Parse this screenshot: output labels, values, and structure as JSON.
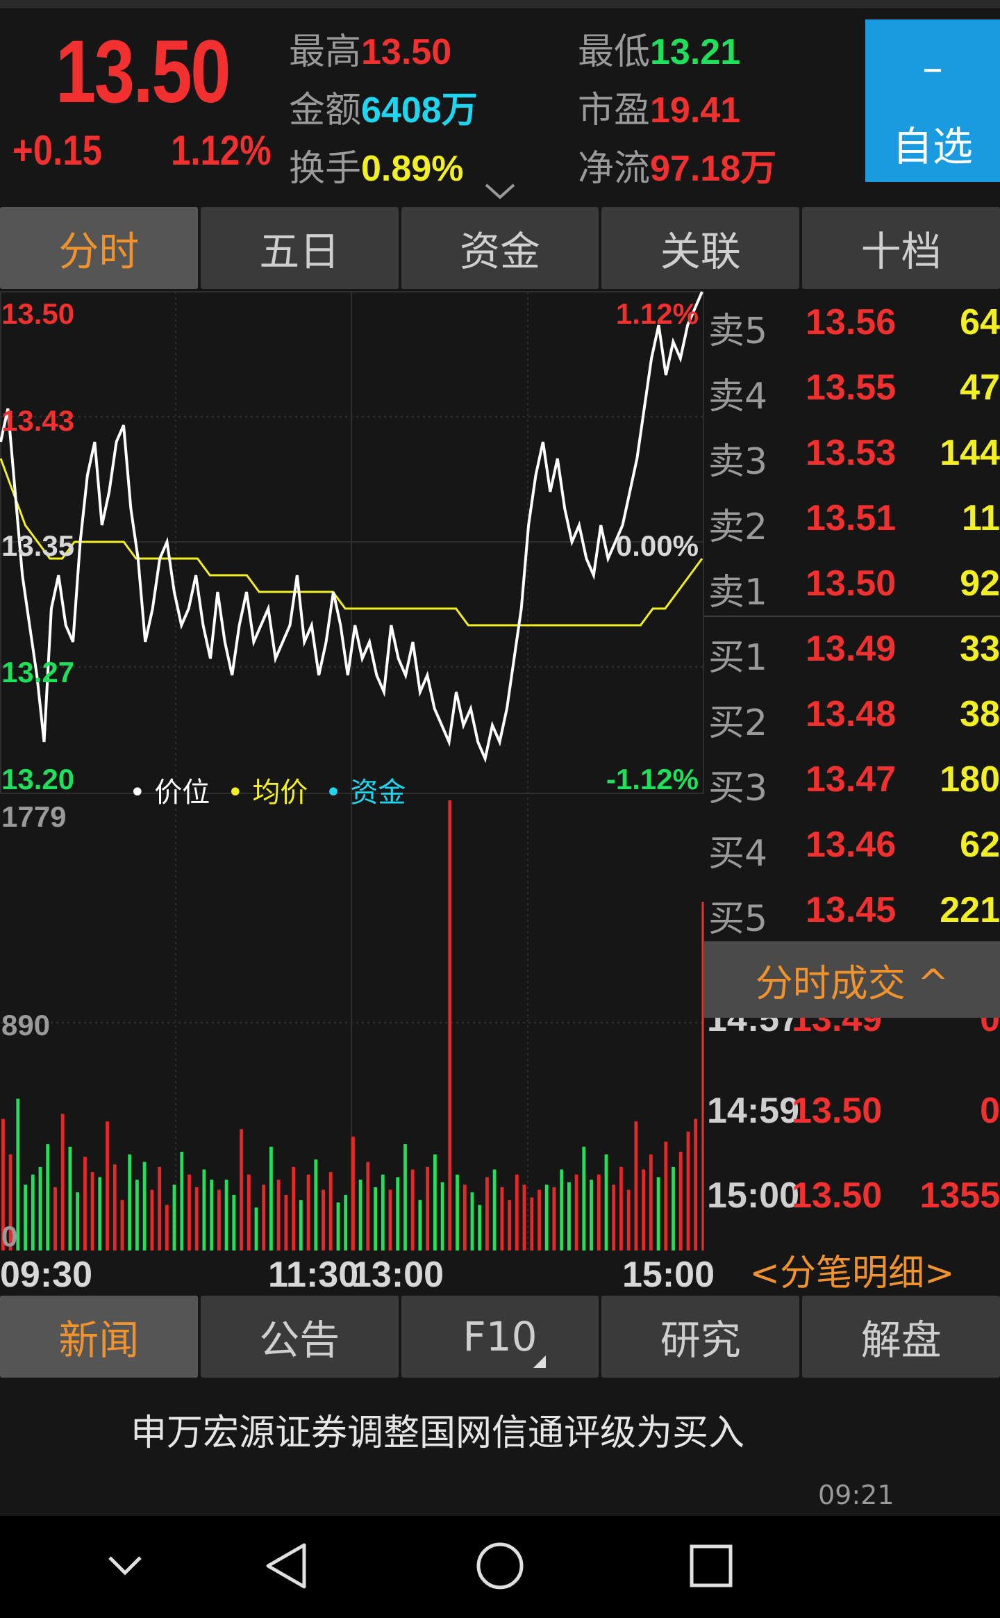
{
  "quote": {
    "price": "13.50",
    "change": "+0.15",
    "change_pct": "1.12%",
    "stats": [
      {
        "label": "最高",
        "value": "13.50",
        "color": "red"
      },
      {
        "label": "最低",
        "value": "13.21",
        "color": "green"
      },
      {
        "label": "金额",
        "value": "6408万",
        "color": "cyan"
      },
      {
        "label": "市盈",
        "value": "19.41",
        "color": "red"
      },
      {
        "label": "换手",
        "value": "0.89%",
        "color": "yellow"
      },
      {
        "label": "净流",
        "value": "97.18万",
        "color": "red"
      }
    ],
    "watch_button": {
      "icon": "minus-icon",
      "label": "自选"
    },
    "expand_icon": "chevron-down-icon"
  },
  "chart_tabs": [
    {
      "label": "分时",
      "active": true
    },
    {
      "label": "五日",
      "active": false
    },
    {
      "label": "资金",
      "active": false
    },
    {
      "label": "关联",
      "active": false
    },
    {
      "label": "十档",
      "active": false
    }
  ],
  "chart": {
    "price_axis": {
      "top": "13.50",
      "upper": "13.43",
      "mid": "13.35",
      "lower": "13.27",
      "bottom": "13.20"
    },
    "pct_axis": {
      "top": "1.12%",
      "mid": "0.00%",
      "bottom": "-1.12%"
    },
    "legend": [
      {
        "label": "价位",
        "color": "#ffffff"
      },
      {
        "label": "均价",
        "color": "#f2ef22"
      },
      {
        "label": "资金",
        "color": "#1fd6f0"
      }
    ],
    "volume_axis": {
      "top": "1779",
      "mid": "890",
      "bottom": "0"
    },
    "time_labels": [
      "09:30",
      "11:30",
      "13:00",
      "15:00"
    ]
  },
  "chart_data": {
    "type": "line",
    "ylim": [
      13.2,
      13.5
    ],
    "series": [
      {
        "name": "价位",
        "values": [
          13.41,
          13.43,
          13.38,
          13.33,
          13.3,
          13.27,
          13.23,
          13.31,
          13.33,
          13.3,
          13.29,
          13.35,
          13.39,
          13.41,
          13.36,
          13.38,
          13.41,
          13.42,
          13.37,
          13.34,
          13.29,
          13.31,
          13.34,
          13.35,
          13.32,
          13.3,
          13.31,
          13.33,
          13.3,
          13.28,
          13.32,
          13.29,
          13.27,
          13.3,
          13.32,
          13.29,
          13.3,
          13.31,
          13.28,
          13.29,
          13.3,
          13.33,
          13.29,
          13.3,
          13.27,
          13.29,
          13.32,
          13.3,
          13.27,
          13.3,
          13.28,
          13.29,
          13.27,
          13.26,
          13.3,
          13.28,
          13.27,
          13.29,
          13.26,
          13.27,
          13.25,
          13.24,
          13.23,
          13.26,
          13.24,
          13.25,
          13.23,
          13.22,
          13.24,
          13.23,
          13.25,
          13.28,
          13.31,
          13.36,
          13.39,
          13.41,
          13.38,
          13.4,
          13.37,
          13.35,
          13.36,
          13.34,
          13.33,
          13.36,
          13.34,
          13.35,
          13.36,
          13.38,
          13.4,
          13.43,
          13.46,
          13.48,
          13.45,
          13.47,
          13.46,
          13.48,
          13.49,
          13.5
        ]
      },
      {
        "name": "均价",
        "values": [
          13.4,
          13.38,
          13.36,
          13.35,
          13.34,
          13.34,
          13.35,
          13.35,
          13.35,
          13.35,
          13.35,
          13.34,
          13.34,
          13.34,
          13.34,
          13.34,
          13.34,
          13.33,
          13.33,
          13.33,
          13.33,
          13.32,
          13.32,
          13.32,
          13.32,
          13.32,
          13.32,
          13.32,
          13.31,
          13.31,
          13.31,
          13.31,
          13.31,
          13.31,
          13.31,
          13.31,
          13.31,
          13.31,
          13.3,
          13.3,
          13.3,
          13.3,
          13.3,
          13.3,
          13.3,
          13.3,
          13.3,
          13.3,
          13.3,
          13.3,
          13.3,
          13.3,
          13.3,
          13.31,
          13.31,
          13.32,
          13.33,
          13.34
        ]
      }
    ],
    "volume_ylim": [
      0,
      1779
    ],
    "volumes": [
      520,
      380,
      600,
      260,
      300,
      330,
      420,
      250,
      540,
      410,
      230,
      370,
      310,
      290,
      510,
      340,
      200,
      380,
      280,
      350,
      240,
      330,
      180,
      260,
      390,
      300,
      250,
      320,
      280,
      240,
      280,
      220,
      480,
      300,
      170,
      260,
      410,
      280,
      220,
      330,
      200,
      300,
      360,
      240,
      310,
      190,
      220,
      450,
      280,
      350,
      250,
      300,
      240,
      290,
      420,
      320,
      200,
      330,
      380,
      270,
      1779,
      300,
      260,
      230,
      180,
      290,
      320,
      250,
      200,
      300,
      260,
      210,
      240,
      260,
      250,
      320,
      270,
      300,
      410,
      280,
      300,
      380,
      260,
      330,
      240,
      510,
      320,
      380,
      290,
      430,
      330,
      390,
      470,
      520
    ],
    "volume_colors": "alternating red/green by price move"
  },
  "order_book": {
    "asks": [
      {
        "label": "卖5",
        "price": "13.56",
        "volume": "64"
      },
      {
        "label": "卖4",
        "price": "13.55",
        "volume": "47"
      },
      {
        "label": "卖3",
        "price": "13.53",
        "volume": "144"
      },
      {
        "label": "卖2",
        "price": "13.51",
        "volume": "11"
      },
      {
        "label": "卖1",
        "price": "13.50",
        "volume": "92"
      }
    ],
    "bids": [
      {
        "label": "买1",
        "price": "13.49",
        "volume": "33"
      },
      {
        "label": "买2",
        "price": "13.48",
        "volume": "38"
      },
      {
        "label": "买3",
        "price": "13.47",
        "volume": "180"
      },
      {
        "label": "买4",
        "price": "13.46",
        "volume": "62"
      },
      {
        "label": "买5",
        "price": "13.45",
        "volume": "221"
      }
    ]
  },
  "ticks": {
    "header": "分时成交 ^",
    "rows": [
      {
        "time": "14:57",
        "price": "13.49",
        "volume": "0"
      },
      {
        "time": "14:59",
        "price": "13.50",
        "volume": "0"
      },
      {
        "time": "15:00",
        "price": "13.50",
        "volume": "1355"
      }
    ],
    "detail_link": "<分笔明细>"
  },
  "news_tabs": [
    {
      "label": "新闻",
      "active": true
    },
    {
      "label": "公告",
      "active": false
    },
    {
      "label": "F10",
      "active": false
    },
    {
      "label": "研究",
      "active": false
    },
    {
      "label": "解盘",
      "active": false
    }
  ],
  "news": {
    "title": "申万宏源证券调整国网信通评级为买入",
    "time": "09:21"
  },
  "navbar": [
    "chevron-down-icon",
    "back-icon",
    "home-icon",
    "recents-icon"
  ]
}
